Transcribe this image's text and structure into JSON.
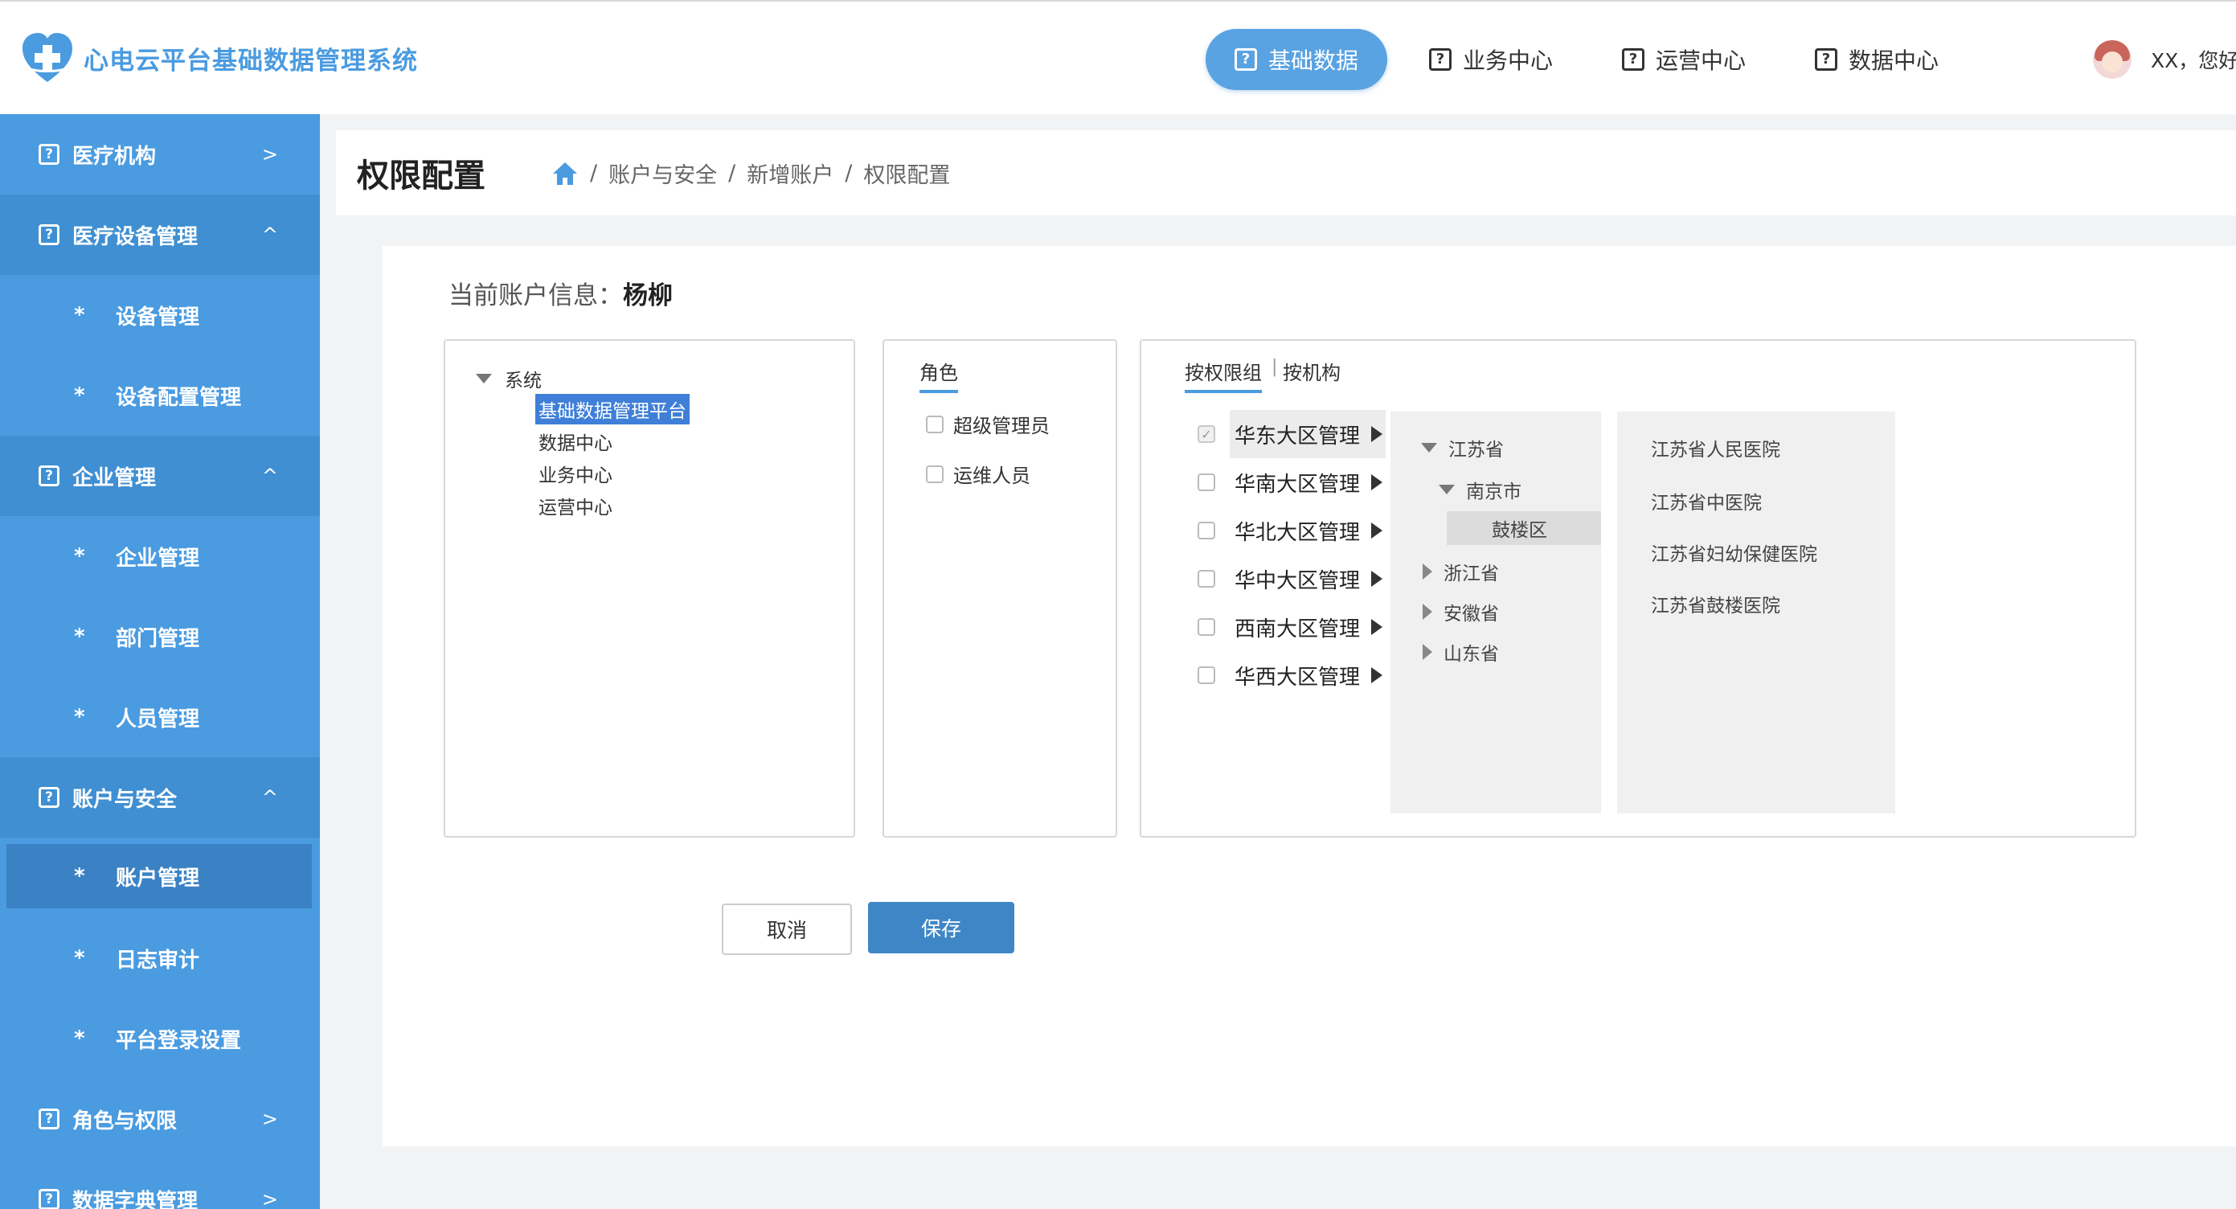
{
  "app": {
    "title": "心电云平台基础数据管理系统"
  },
  "top_nav": [
    {
      "label": "基础数据",
      "active": true
    },
    {
      "label": "业务中心",
      "active": false
    },
    {
      "label": "运营中心",
      "active": false
    },
    {
      "label": "数据中心",
      "active": false
    }
  ],
  "user": {
    "greeting": "XX，您好"
  },
  "sidebar": [
    {
      "label": "医疗机构",
      "type": "group",
      "arrow": ">"
    },
    {
      "label": "医疗设备管理",
      "type": "group",
      "arrow": "^"
    },
    {
      "label": "设备管理",
      "type": "sub"
    },
    {
      "label": "设备配置管理",
      "type": "sub"
    },
    {
      "label": "企业管理",
      "type": "group",
      "arrow": "^"
    },
    {
      "label": "企业管理",
      "type": "sub"
    },
    {
      "label": "部门管理",
      "type": "sub"
    },
    {
      "label": "人员管理",
      "type": "sub"
    },
    {
      "label": "账户与安全",
      "type": "group",
      "arrow": "^"
    },
    {
      "label": "账户管理",
      "type": "sub",
      "selected": true
    },
    {
      "label": "日志审计",
      "type": "sub"
    },
    {
      "label": "平台登录设置",
      "type": "sub"
    },
    {
      "label": "角色与权限",
      "type": "group",
      "arrow": ">"
    },
    {
      "label": "数据字典管理",
      "type": "group",
      "arrow": ">"
    }
  ],
  "sidebar_star": "*",
  "page": {
    "title": "权限配置",
    "breadcrumb": [
      "账户与安全",
      "新增账户",
      "权限配置"
    ],
    "breadcrumb_sep": "/"
  },
  "account": {
    "label": "当前账户信息：",
    "name": "杨柳"
  },
  "system_tree": {
    "root": "系统",
    "children": [
      {
        "label": "基础数据管理平台",
        "selected": true
      },
      {
        "label": "数据中心"
      },
      {
        "label": "业务中心"
      },
      {
        "label": "运营中心"
      }
    ]
  },
  "roles": {
    "title": "角色",
    "items": [
      {
        "label": "超级管理员",
        "checked": false
      },
      {
        "label": "运维人员",
        "checked": false
      }
    ]
  },
  "scope": {
    "tabs": [
      {
        "label": "按权限组",
        "active": true
      },
      {
        "label": "按机构",
        "active": false
      }
    ],
    "tab_separator": "|",
    "regions": [
      {
        "label": "华东大区管理",
        "checked": true,
        "active": true
      },
      {
        "label": "华南大区管理",
        "checked": false
      },
      {
        "label": "华北大区管理",
        "checked": false
      },
      {
        "label": "华中大区管理",
        "checked": false
      },
      {
        "label": "西南大区管理",
        "checked": false
      },
      {
        "label": "华西大区管理",
        "checked": false
      }
    ],
    "areas": {
      "province": "江苏省",
      "city": "南京市",
      "district": "鼓楼区",
      "other_provinces": [
        "浙江省",
        "安徽省",
        "山东省"
      ]
    },
    "hospitals": [
      "江苏省人民医院",
      "江苏省中医院",
      "江苏省妇幼保健医院",
      "江苏省鼓楼医院"
    ]
  },
  "actions": {
    "cancel": "取消",
    "save": "保存"
  },
  "colors": {
    "primary": "#4a9be0",
    "save_button": "#3f86c6",
    "tree_selected": "#3f7fd8"
  },
  "icons": {
    "nav": "help-square-icon",
    "home": "home-icon",
    "logo": "heart-cross-logo-icon"
  }
}
